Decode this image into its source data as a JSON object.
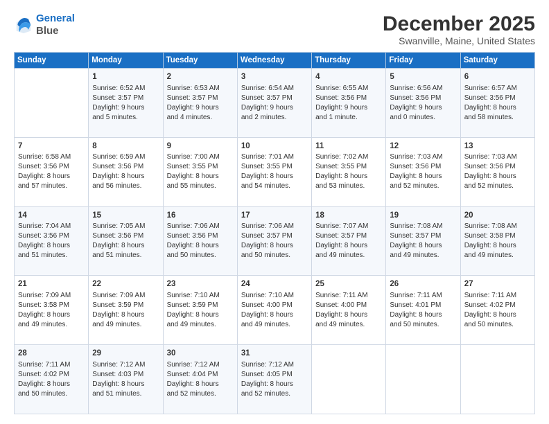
{
  "header": {
    "logo_line1": "General",
    "logo_line2": "Blue",
    "title": "December 2025",
    "subtitle": "Swanville, Maine, United States"
  },
  "days_of_week": [
    "Sunday",
    "Monday",
    "Tuesday",
    "Wednesday",
    "Thursday",
    "Friday",
    "Saturday"
  ],
  "weeks": [
    [
      {
        "day": "",
        "content": ""
      },
      {
        "day": "1",
        "content": "Sunrise: 6:52 AM\nSunset: 3:57 PM\nDaylight: 9 hours\nand 5 minutes."
      },
      {
        "day": "2",
        "content": "Sunrise: 6:53 AM\nSunset: 3:57 PM\nDaylight: 9 hours\nand 4 minutes."
      },
      {
        "day": "3",
        "content": "Sunrise: 6:54 AM\nSunset: 3:57 PM\nDaylight: 9 hours\nand 2 minutes."
      },
      {
        "day": "4",
        "content": "Sunrise: 6:55 AM\nSunset: 3:56 PM\nDaylight: 9 hours\nand 1 minute."
      },
      {
        "day": "5",
        "content": "Sunrise: 6:56 AM\nSunset: 3:56 PM\nDaylight: 9 hours\nand 0 minutes."
      },
      {
        "day": "6",
        "content": "Sunrise: 6:57 AM\nSunset: 3:56 PM\nDaylight: 8 hours\nand 58 minutes."
      }
    ],
    [
      {
        "day": "7",
        "content": "Sunrise: 6:58 AM\nSunset: 3:56 PM\nDaylight: 8 hours\nand 57 minutes."
      },
      {
        "day": "8",
        "content": "Sunrise: 6:59 AM\nSunset: 3:56 PM\nDaylight: 8 hours\nand 56 minutes."
      },
      {
        "day": "9",
        "content": "Sunrise: 7:00 AM\nSunset: 3:55 PM\nDaylight: 8 hours\nand 55 minutes."
      },
      {
        "day": "10",
        "content": "Sunrise: 7:01 AM\nSunset: 3:55 PM\nDaylight: 8 hours\nand 54 minutes."
      },
      {
        "day": "11",
        "content": "Sunrise: 7:02 AM\nSunset: 3:55 PM\nDaylight: 8 hours\nand 53 minutes."
      },
      {
        "day": "12",
        "content": "Sunrise: 7:03 AM\nSunset: 3:56 PM\nDaylight: 8 hours\nand 52 minutes."
      },
      {
        "day": "13",
        "content": "Sunrise: 7:03 AM\nSunset: 3:56 PM\nDaylight: 8 hours\nand 52 minutes."
      }
    ],
    [
      {
        "day": "14",
        "content": "Sunrise: 7:04 AM\nSunset: 3:56 PM\nDaylight: 8 hours\nand 51 minutes."
      },
      {
        "day": "15",
        "content": "Sunrise: 7:05 AM\nSunset: 3:56 PM\nDaylight: 8 hours\nand 51 minutes."
      },
      {
        "day": "16",
        "content": "Sunrise: 7:06 AM\nSunset: 3:56 PM\nDaylight: 8 hours\nand 50 minutes."
      },
      {
        "day": "17",
        "content": "Sunrise: 7:06 AM\nSunset: 3:57 PM\nDaylight: 8 hours\nand 50 minutes."
      },
      {
        "day": "18",
        "content": "Sunrise: 7:07 AM\nSunset: 3:57 PM\nDaylight: 8 hours\nand 49 minutes."
      },
      {
        "day": "19",
        "content": "Sunrise: 7:08 AM\nSunset: 3:57 PM\nDaylight: 8 hours\nand 49 minutes."
      },
      {
        "day": "20",
        "content": "Sunrise: 7:08 AM\nSunset: 3:58 PM\nDaylight: 8 hours\nand 49 minutes."
      }
    ],
    [
      {
        "day": "21",
        "content": "Sunrise: 7:09 AM\nSunset: 3:58 PM\nDaylight: 8 hours\nand 49 minutes."
      },
      {
        "day": "22",
        "content": "Sunrise: 7:09 AM\nSunset: 3:59 PM\nDaylight: 8 hours\nand 49 minutes."
      },
      {
        "day": "23",
        "content": "Sunrise: 7:10 AM\nSunset: 3:59 PM\nDaylight: 8 hours\nand 49 minutes."
      },
      {
        "day": "24",
        "content": "Sunrise: 7:10 AM\nSunset: 4:00 PM\nDaylight: 8 hours\nand 49 minutes."
      },
      {
        "day": "25",
        "content": "Sunrise: 7:11 AM\nSunset: 4:00 PM\nDaylight: 8 hours\nand 49 minutes."
      },
      {
        "day": "26",
        "content": "Sunrise: 7:11 AM\nSunset: 4:01 PM\nDaylight: 8 hours\nand 50 minutes."
      },
      {
        "day": "27",
        "content": "Sunrise: 7:11 AM\nSunset: 4:02 PM\nDaylight: 8 hours\nand 50 minutes."
      }
    ],
    [
      {
        "day": "28",
        "content": "Sunrise: 7:11 AM\nSunset: 4:02 PM\nDaylight: 8 hours\nand 50 minutes."
      },
      {
        "day": "29",
        "content": "Sunrise: 7:12 AM\nSunset: 4:03 PM\nDaylight: 8 hours\nand 51 minutes."
      },
      {
        "day": "30",
        "content": "Sunrise: 7:12 AM\nSunset: 4:04 PM\nDaylight: 8 hours\nand 52 minutes."
      },
      {
        "day": "31",
        "content": "Sunrise: 7:12 AM\nSunset: 4:05 PM\nDaylight: 8 hours\nand 52 minutes."
      },
      {
        "day": "",
        "content": ""
      },
      {
        "day": "",
        "content": ""
      },
      {
        "day": "",
        "content": ""
      }
    ]
  ]
}
